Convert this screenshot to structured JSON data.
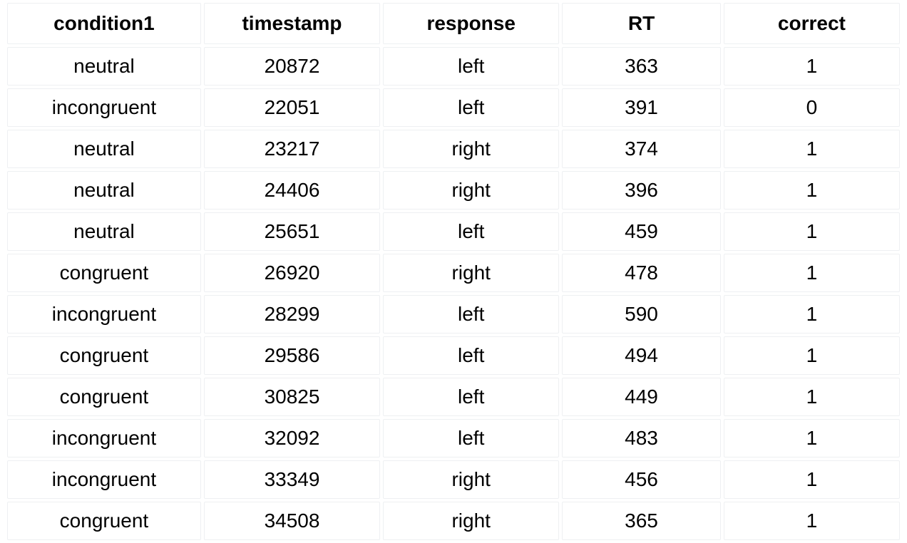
{
  "chart_data": {
    "type": "table",
    "columns": [
      "condition1",
      "timestamp",
      "response",
      "RT",
      "correct"
    ],
    "rows": [
      {
        "condition1": "neutral",
        "timestamp": 20872,
        "response": "left",
        "RT": 363,
        "correct": 1
      },
      {
        "condition1": "incongruent",
        "timestamp": 22051,
        "response": "left",
        "RT": 391,
        "correct": 0
      },
      {
        "condition1": "neutral",
        "timestamp": 23217,
        "response": "right",
        "RT": 374,
        "correct": 1
      },
      {
        "condition1": "neutral",
        "timestamp": 24406,
        "response": "right",
        "RT": 396,
        "correct": 1
      },
      {
        "condition1": "neutral",
        "timestamp": 25651,
        "response": "left",
        "RT": 459,
        "correct": 1
      },
      {
        "condition1": "congruent",
        "timestamp": 26920,
        "response": "right",
        "RT": 478,
        "correct": 1
      },
      {
        "condition1": "incongruent",
        "timestamp": 28299,
        "response": "left",
        "RT": 590,
        "correct": 1
      },
      {
        "condition1": "congruent",
        "timestamp": 29586,
        "response": "left",
        "RT": 494,
        "correct": 1
      },
      {
        "condition1": "congruent",
        "timestamp": 30825,
        "response": "left",
        "RT": 449,
        "correct": 1
      },
      {
        "condition1": "incongruent",
        "timestamp": 32092,
        "response": "left",
        "RT": 483,
        "correct": 1
      },
      {
        "condition1": "incongruent",
        "timestamp": 33349,
        "response": "right",
        "RT": 456,
        "correct": 1
      },
      {
        "condition1": "congruent",
        "timestamp": 34508,
        "response": "right",
        "RT": 365,
        "correct": 1
      }
    ]
  }
}
